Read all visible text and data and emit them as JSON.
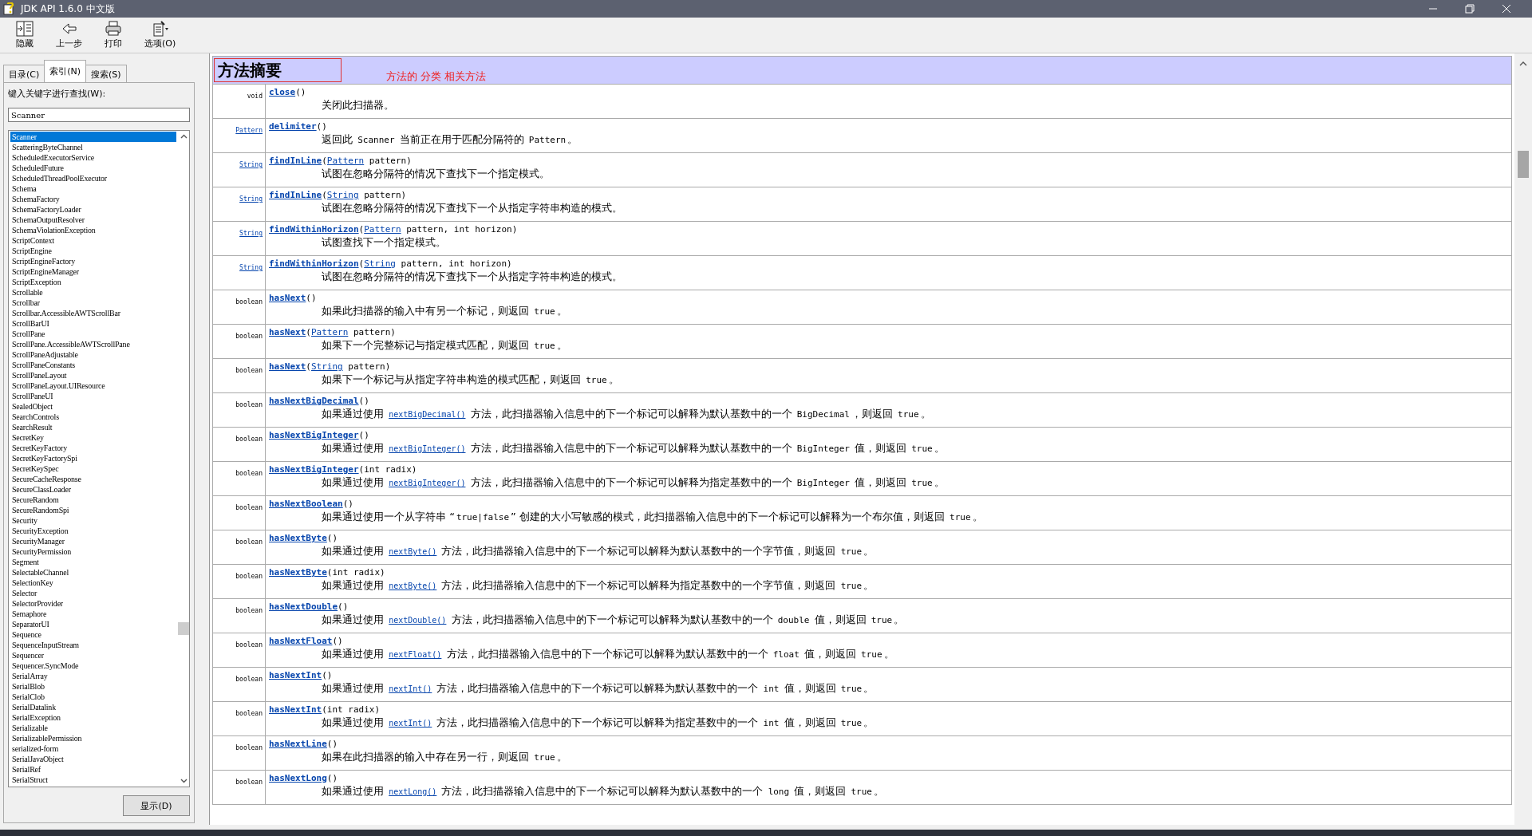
{
  "window": {
    "title": "JDK API 1.6.0 中文版"
  },
  "toolbar": [
    {
      "label": "隐藏",
      "kind": "hide"
    },
    {
      "label": "上一步",
      "kind": "back"
    },
    {
      "label": "打印",
      "kind": "print"
    },
    {
      "label": "选项(O)",
      "kind": "options"
    }
  ],
  "tabs": [
    {
      "label": "目录(C)",
      "selected": false
    },
    {
      "label": "索引(N)",
      "selected": true
    },
    {
      "label": "搜索(S)",
      "selected": false
    }
  ],
  "index": {
    "prompt": "键入关键字进行查找(W):",
    "query": "Scanner",
    "show_button": "显示(D)",
    "items": [
      {
        "label": "Scanner",
        "selected": true
      },
      {
        "label": "ScatteringByteChannel",
        "selected": false
      },
      {
        "label": "ScheduledExecutorService",
        "selected": false
      },
      {
        "label": "ScheduledFuture",
        "selected": false
      },
      {
        "label": "ScheduledThreadPoolExecutor",
        "selected": false
      },
      {
        "label": "Schema",
        "selected": false
      },
      {
        "label": "SchemaFactory",
        "selected": false
      },
      {
        "label": "SchemaFactoryLoader",
        "selected": false
      },
      {
        "label": "SchemaOutputResolver",
        "selected": false
      },
      {
        "label": "SchemaViolationException",
        "selected": false
      },
      {
        "label": "ScriptContext",
        "selected": false
      },
      {
        "label": "ScriptEngine",
        "selected": false
      },
      {
        "label": "ScriptEngineFactory",
        "selected": false
      },
      {
        "label": "ScriptEngineManager",
        "selected": false
      },
      {
        "label": "ScriptException",
        "selected": false
      },
      {
        "label": "Scrollable",
        "selected": false
      },
      {
        "label": "Scrollbar",
        "selected": false
      },
      {
        "label": "Scrollbar.AccessibleAWTScrollBar",
        "selected": false
      },
      {
        "label": "ScrollBarUI",
        "selected": false
      },
      {
        "label": "ScrollPane",
        "selected": false
      },
      {
        "label": "ScrollPane.AccessibleAWTScrollPane",
        "selected": false
      },
      {
        "label": "ScrollPaneAdjustable",
        "selected": false
      },
      {
        "label": "ScrollPaneConstants",
        "selected": false
      },
      {
        "label": "ScrollPaneLayout",
        "selected": false
      },
      {
        "label": "ScrollPaneLayout.UIResource",
        "selected": false
      },
      {
        "label": "ScrollPaneUI",
        "selected": false
      },
      {
        "label": "SealedObject",
        "selected": false
      },
      {
        "label": "SearchControls",
        "selected": false
      },
      {
        "label": "SearchResult",
        "selected": false
      },
      {
        "label": "SecretKey",
        "selected": false
      },
      {
        "label": "SecretKeyFactory",
        "selected": false
      },
      {
        "label": "SecretKeyFactorySpi",
        "selected": false
      },
      {
        "label": "SecretKeySpec",
        "selected": false
      },
      {
        "label": "SecureCacheResponse",
        "selected": false
      },
      {
        "label": "SecureClassLoader",
        "selected": false
      },
      {
        "label": "SecureRandom",
        "selected": false
      },
      {
        "label": "SecureRandomSpi",
        "selected": false
      },
      {
        "label": "Security",
        "selected": false
      },
      {
        "label": "SecurityException",
        "selected": false
      },
      {
        "label": "SecurityManager",
        "selected": false
      },
      {
        "label": "SecurityPermission",
        "selected": false
      },
      {
        "label": "Segment",
        "selected": false
      },
      {
        "label": "SelectableChannel",
        "selected": false
      },
      {
        "label": "SelectionKey",
        "selected": false
      },
      {
        "label": "Selector",
        "selected": false
      },
      {
        "label": "SelectorProvider",
        "selected": false
      },
      {
        "label": "Semaphore",
        "selected": false
      },
      {
        "label": "SeparatorUI",
        "selected": false
      },
      {
        "label": "Sequence",
        "selected": false
      },
      {
        "label": "SequenceInputStream",
        "selected": false
      },
      {
        "label": "Sequencer",
        "selected": false
      },
      {
        "label": "Sequencer.SyncMode",
        "selected": false
      },
      {
        "label": "SerialArray",
        "selected": false
      },
      {
        "label": "SerialBlob",
        "selected": false
      },
      {
        "label": "SerialClob",
        "selected": false
      },
      {
        "label": "SerialDatalink",
        "selected": false
      },
      {
        "label": "SerialException",
        "selected": false
      },
      {
        "label": "Serializable",
        "selected": false
      },
      {
        "label": "SerializablePermission",
        "selected": false
      },
      {
        "label": "serialized-form",
        "selected": false
      },
      {
        "label": "SerialJavaObject",
        "selected": false
      },
      {
        "label": "SerialRef",
        "selected": false
      },
      {
        "label": "SerialStruct",
        "selected": false
      }
    ]
  },
  "summary": {
    "heading": "方法摘要",
    "annotation": "方法的 分类 相关方法",
    "methods": [
      {
        "type": {
          "text": "void",
          "link": false
        },
        "name": "close",
        "params": [
          {
            "text": "()"
          }
        ],
        "desc": [
          {
            "kind": "text",
            "text": "关闭此扫描器。"
          }
        ]
      },
      {
        "type": {
          "text": "Pattern",
          "link": true
        },
        "name": "delimiter",
        "params": [
          {
            "text": "()"
          }
        ],
        "desc": [
          {
            "kind": "text",
            "text": "返回此 "
          },
          {
            "kind": "code",
            "text": "Scanner"
          },
          {
            "kind": "text",
            "text": " 当前正在用于匹配分隔符的 "
          },
          {
            "kind": "code",
            "text": "Pattern"
          },
          {
            "kind": "text",
            "text": "。"
          }
        ]
      },
      {
        "type": {
          "text": "String",
          "link": true
        },
        "name": "findInLine",
        "params": [
          {
            "text": "("
          },
          {
            "text": "Pattern",
            "link": true
          },
          {
            "text": " pattern)"
          }
        ],
        "desc": [
          {
            "kind": "text",
            "text": "试图在忽略分隔符的情况下查找下一个指定模式。"
          }
        ]
      },
      {
        "type": {
          "text": "String",
          "link": true
        },
        "name": "findInLine",
        "params": [
          {
            "text": "("
          },
          {
            "text": "String",
            "link": true
          },
          {
            "text": " pattern)"
          }
        ],
        "desc": [
          {
            "kind": "text",
            "text": "试图在忽略分隔符的情况下查找下一个从指定字符串构造的模式。"
          }
        ]
      },
      {
        "type": {
          "text": "String",
          "link": true
        },
        "name": "findWithinHorizon",
        "params": [
          {
            "text": "("
          },
          {
            "text": "Pattern",
            "link": true
          },
          {
            "text": " pattern, int horizon)"
          }
        ],
        "desc": [
          {
            "kind": "text",
            "text": "试图查找下一个指定模式。"
          }
        ]
      },
      {
        "type": {
          "text": "String",
          "link": true
        },
        "name": "findWithinHorizon",
        "params": [
          {
            "text": "("
          },
          {
            "text": "String",
            "link": true
          },
          {
            "text": " pattern, int horizon)"
          }
        ],
        "desc": [
          {
            "kind": "text",
            "text": "试图在忽略分隔符的情况下查找下一个从指定字符串构造的模式。"
          }
        ]
      },
      {
        "type": {
          "text": "boolean",
          "link": false
        },
        "name": "hasNext",
        "params": [
          {
            "text": "()"
          }
        ],
        "desc": [
          {
            "kind": "text",
            "text": "如果此扫描器的输入中有另一个标记，则返回 "
          },
          {
            "kind": "code",
            "text": "true"
          },
          {
            "kind": "text",
            "text": "。"
          }
        ]
      },
      {
        "type": {
          "text": "boolean",
          "link": false
        },
        "name": "hasNext",
        "params": [
          {
            "text": "("
          },
          {
            "text": "Pattern",
            "link": true
          },
          {
            "text": " pattern)"
          }
        ],
        "desc": [
          {
            "kind": "text",
            "text": "如果下一个完整标记与指定模式匹配，则返回 "
          },
          {
            "kind": "code",
            "text": "true"
          },
          {
            "kind": "text",
            "text": "。"
          }
        ]
      },
      {
        "type": {
          "text": "boolean",
          "link": false
        },
        "name": "hasNext",
        "params": [
          {
            "text": "("
          },
          {
            "text": "String",
            "link": true
          },
          {
            "text": " pattern)"
          }
        ],
        "desc": [
          {
            "kind": "text",
            "text": "如果下一个标记与从指定字符串构造的模式匹配，则返回 "
          },
          {
            "kind": "code",
            "text": "true"
          },
          {
            "kind": "text",
            "text": "。"
          }
        ]
      },
      {
        "type": {
          "text": "boolean",
          "link": false
        },
        "name": "hasNextBigDecimal",
        "params": [
          {
            "text": "()"
          }
        ],
        "desc": [
          {
            "kind": "text",
            "text": "如果通过使用 "
          },
          {
            "kind": "link",
            "text": "nextBigDecimal()"
          },
          {
            "kind": "text",
            "text": " 方法，此扫描器输入信息中的下一个标记可以解释为默认基数中的一个 "
          },
          {
            "kind": "code",
            "text": "BigDecimal"
          },
          {
            "kind": "text",
            "text": "，则返回 "
          },
          {
            "kind": "code",
            "text": "true"
          },
          {
            "kind": "text",
            "text": "。"
          }
        ]
      },
      {
        "type": {
          "text": "boolean",
          "link": false
        },
        "name": "hasNextBigInteger",
        "params": [
          {
            "text": "()"
          }
        ],
        "desc": [
          {
            "kind": "text",
            "text": "如果通过使用 "
          },
          {
            "kind": "link",
            "text": "nextBigInteger()"
          },
          {
            "kind": "text",
            "text": " 方法，此扫描器输入信息中的下一个标记可以解释为默认基数中的一个 "
          },
          {
            "kind": "code",
            "text": "BigInteger"
          },
          {
            "kind": "text",
            "text": " 值，则返回 "
          },
          {
            "kind": "code",
            "text": "true"
          },
          {
            "kind": "text",
            "text": "。"
          }
        ]
      },
      {
        "type": {
          "text": "boolean",
          "link": false
        },
        "name": "hasNextBigInteger",
        "params": [
          {
            "text": "(int radix)"
          }
        ],
        "desc": [
          {
            "kind": "text",
            "text": "如果通过使用 "
          },
          {
            "kind": "link",
            "text": "nextBigInteger()"
          },
          {
            "kind": "text",
            "text": " 方法，此扫描器输入信息中的下一个标记可以解释为指定基数中的一个 "
          },
          {
            "kind": "code",
            "text": "BigInteger"
          },
          {
            "kind": "text",
            "text": " 值，则返回 "
          },
          {
            "kind": "code",
            "text": "true"
          },
          {
            "kind": "text",
            "text": "。"
          }
        ]
      },
      {
        "type": {
          "text": "boolean",
          "link": false
        },
        "name": "hasNextBoolean",
        "params": [
          {
            "text": "()"
          }
        ],
        "desc": [
          {
            "kind": "text",
            "text": "如果通过使用一个从字符串 “"
          },
          {
            "kind": "code",
            "text": "true|false"
          },
          {
            "kind": "text",
            "text": "” 创建的大小写敏感的模式，此扫描器输入信息中的下一个标记可以解释为一个布尔值，则返回 "
          },
          {
            "kind": "code",
            "text": "true"
          },
          {
            "kind": "text",
            "text": "。"
          }
        ]
      },
      {
        "type": {
          "text": "boolean",
          "link": false
        },
        "name": "hasNextByte",
        "params": [
          {
            "text": "()"
          }
        ],
        "desc": [
          {
            "kind": "text",
            "text": "如果通过使用 "
          },
          {
            "kind": "link",
            "text": "nextByte()"
          },
          {
            "kind": "text",
            "text": " 方法，此扫描器输入信息中的下一个标记可以解释为默认基数中的一个字节值，则返回 "
          },
          {
            "kind": "code",
            "text": "true"
          },
          {
            "kind": "text",
            "text": "。"
          }
        ]
      },
      {
        "type": {
          "text": "boolean",
          "link": false
        },
        "name": "hasNextByte",
        "params": [
          {
            "text": "(int radix)"
          }
        ],
        "desc": [
          {
            "kind": "text",
            "text": "如果通过使用 "
          },
          {
            "kind": "link",
            "text": "nextByte()"
          },
          {
            "kind": "text",
            "text": " 方法，此扫描器输入信息中的下一个标记可以解释为指定基数中的一个字节值，则返回 "
          },
          {
            "kind": "code",
            "text": "true"
          },
          {
            "kind": "text",
            "text": "。"
          }
        ]
      },
      {
        "type": {
          "text": "boolean",
          "link": false
        },
        "name": "hasNextDouble",
        "params": [
          {
            "text": "()"
          }
        ],
        "desc": [
          {
            "kind": "text",
            "text": "如果通过使用 "
          },
          {
            "kind": "link",
            "text": "nextDouble()"
          },
          {
            "kind": "text",
            "text": " 方法，此扫描器输入信息中的下一个标记可以解释为默认基数中的一个 "
          },
          {
            "kind": "code",
            "text": "double"
          },
          {
            "kind": "text",
            "text": " 值，则返回 "
          },
          {
            "kind": "code",
            "text": "true"
          },
          {
            "kind": "text",
            "text": "。"
          }
        ]
      },
      {
        "type": {
          "text": "boolean",
          "link": false
        },
        "name": "hasNextFloat",
        "params": [
          {
            "text": "()"
          }
        ],
        "desc": [
          {
            "kind": "text",
            "text": "如果通过使用 "
          },
          {
            "kind": "link",
            "text": "nextFloat()"
          },
          {
            "kind": "text",
            "text": " 方法，此扫描器输入信息中的下一个标记可以解释为默认基数中的一个 "
          },
          {
            "kind": "code",
            "text": "float"
          },
          {
            "kind": "text",
            "text": " 值，则返回 "
          },
          {
            "kind": "code",
            "text": "true"
          },
          {
            "kind": "text",
            "text": "。"
          }
        ]
      },
      {
        "type": {
          "text": "boolean",
          "link": false
        },
        "name": "hasNextInt",
        "params": [
          {
            "text": "()"
          }
        ],
        "desc": [
          {
            "kind": "text",
            "text": "如果通过使用 "
          },
          {
            "kind": "link",
            "text": "nextInt()"
          },
          {
            "kind": "text",
            "text": " 方法，此扫描器输入信息中的下一个标记可以解释为默认基数中的一个 "
          },
          {
            "kind": "code",
            "text": "int"
          },
          {
            "kind": "text",
            "text": " 值，则返回 "
          },
          {
            "kind": "code",
            "text": "true"
          },
          {
            "kind": "text",
            "text": "。"
          }
        ]
      },
      {
        "type": {
          "text": "boolean",
          "link": false
        },
        "name": "hasNextInt",
        "params": [
          {
            "text": "(int radix)"
          }
        ],
        "desc": [
          {
            "kind": "text",
            "text": "如果通过使用 "
          },
          {
            "kind": "link",
            "text": "nextInt()"
          },
          {
            "kind": "text",
            "text": " 方法，此扫描器输入信息中的下一个标记可以解释为指定基数中的一个 "
          },
          {
            "kind": "code",
            "text": "int"
          },
          {
            "kind": "text",
            "text": " 值，则返回 "
          },
          {
            "kind": "code",
            "text": "true"
          },
          {
            "kind": "text",
            "text": "。"
          }
        ]
      },
      {
        "type": {
          "text": "boolean",
          "link": false
        },
        "name": "hasNextLine",
        "params": [
          {
            "text": "()"
          }
        ],
        "desc": [
          {
            "kind": "text",
            "text": "如果在此扫描器的输入中存在另一行，则返回 "
          },
          {
            "kind": "code",
            "text": "true"
          },
          {
            "kind": "text",
            "text": "。"
          }
        ]
      },
      {
        "type": {
          "text": "boolean",
          "link": false
        },
        "name": "hasNextLong",
        "params": [
          {
            "text": "()"
          }
        ],
        "desc": [
          {
            "kind": "text",
            "text": "如果通过使用 "
          },
          {
            "kind": "link",
            "text": "nextLong()"
          },
          {
            "kind": "text",
            "text": " 方法，此扫描器输入信息中的下一个标记可以解释为默认基数中的一个 "
          },
          {
            "kind": "code",
            "text": "long"
          },
          {
            "kind": "text",
            "text": " 值，则返回 "
          },
          {
            "kind": "code",
            "text": "true"
          },
          {
            "kind": "text",
            "text": "。"
          }
        ]
      }
    ]
  }
}
